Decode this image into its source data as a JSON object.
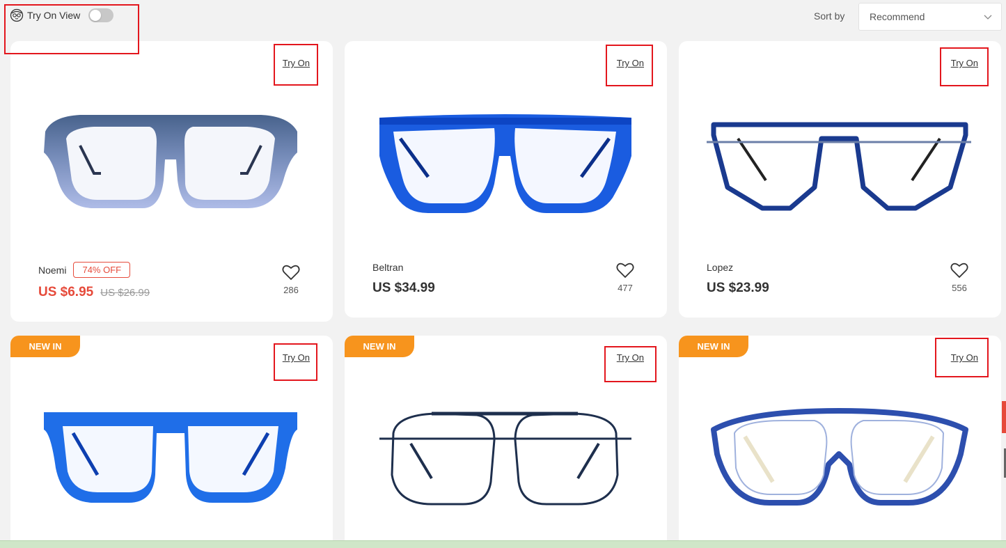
{
  "toolbar": {
    "tryon_view_label": "Try On View",
    "tryon_view_enabled": false,
    "sort_label": "Sort by",
    "sort_value": "Recommend"
  },
  "colors": {
    "accent_red": "#e64a3a",
    "badge_orange": "#f7941d",
    "highlight_box": "#e3161d"
  },
  "products": [
    {
      "name": "Noemi",
      "discount": "74% OFF",
      "price": "US $6.95",
      "old_price": "US $26.99",
      "favorites": "286",
      "try_on": "Try On",
      "badge": "",
      "frame_color": "#3e5a86",
      "style": "square-gradient"
    },
    {
      "name": "Beltran",
      "discount": "",
      "price": "US $34.99",
      "old_price": "",
      "favorites": "477",
      "try_on": "Try On",
      "badge": "",
      "frame_color": "#1a5ce0",
      "style": "flat-top-blue"
    },
    {
      "name": "Lopez",
      "discount": "",
      "price": "US $23.99",
      "old_price": "",
      "favorites": "556",
      "try_on": "Try On",
      "badge": "",
      "frame_color": "#1a3a8f",
      "style": "geometric-navy"
    },
    {
      "name": "",
      "discount": "",
      "price": "",
      "old_price": "",
      "favorites": "",
      "try_on": "Try On",
      "badge": "NEW IN",
      "frame_color": "#1f6ee8",
      "style": "round-blue"
    },
    {
      "name": "",
      "discount": "",
      "price": "",
      "old_price": "",
      "favorites": "",
      "try_on": "Try On",
      "badge": "NEW IN",
      "frame_color": "#1e2f4d",
      "style": "thin-navy"
    },
    {
      "name": "",
      "discount": "",
      "price": "",
      "old_price": "",
      "favorites": "",
      "try_on": "Try On",
      "badge": "NEW IN",
      "frame_color": "#2d4fae",
      "style": "aviator-blue"
    }
  ]
}
